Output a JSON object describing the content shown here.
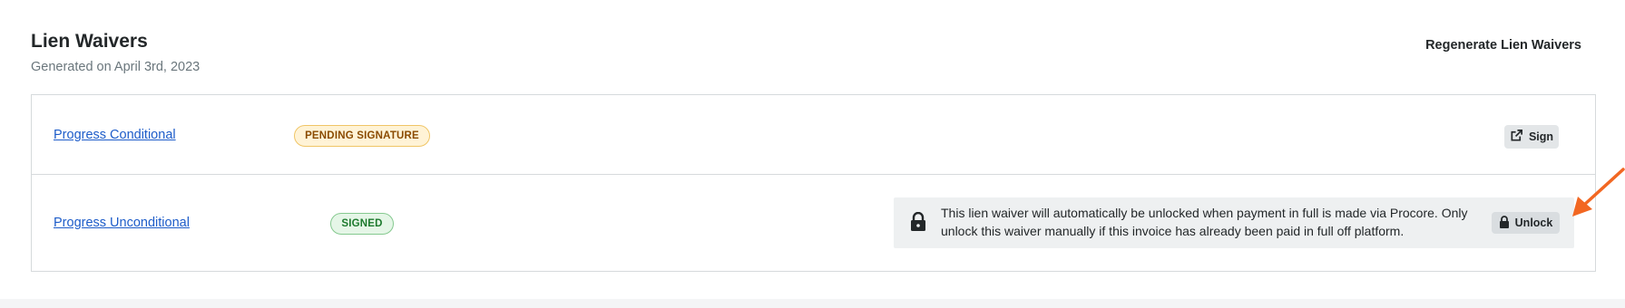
{
  "header": {
    "title": "Lien Waivers",
    "subtitle": "Generated on April 3rd, 2023",
    "regenerate_label": "Regenerate Lien Waivers"
  },
  "waivers": [
    {
      "name": "Progress Conditional",
      "status": "PENDING SIGNATURE",
      "action_label": "Sign",
      "action_icon": "external-link-icon"
    },
    {
      "name": "Progress Unconditional",
      "status": "SIGNED",
      "notice": "This lien waiver will automatically be unlocked when payment in full is made via Procore. Only unlock this waiver manually if this invoice has already been paid in full off platform.",
      "notice_icon": "lock-icon",
      "action_label": "Unlock",
      "action_icon": "lock-icon"
    }
  ],
  "colors": {
    "link": "#1d5cc9",
    "pending_badge_bg": "#fff3d6",
    "pending_badge_text": "#8a4b00",
    "signed_badge_bg": "#e5f6e7",
    "signed_badge_text": "#1d7a2e",
    "annotation_arrow": "#f26722"
  }
}
